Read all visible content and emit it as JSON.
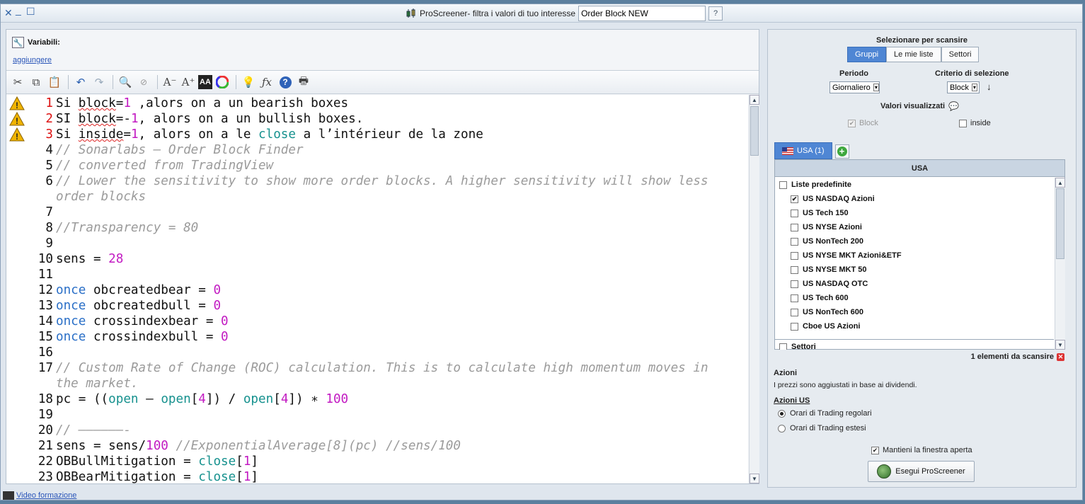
{
  "window": {
    "title": "ProScreener- filtra i valori di tuo interesse",
    "screener_name": "Order Block NEW"
  },
  "variables": {
    "title": "Variabili:",
    "add_link": "aggiungere"
  },
  "toolbar": {
    "icons": [
      "cut-icon",
      "copy-icon",
      "paste-icon",
      "undo-icon",
      "redo-icon",
      "search-icon",
      "comment-icon",
      "font-decrease-icon",
      "font-increase-icon",
      "font-style-icon",
      "color-wheel-icon",
      "lightbulb-icon",
      "function-icon",
      "help-icon",
      "print-icon"
    ]
  },
  "editor": {
    "lines": [
      {
        "n": "1",
        "err": true,
        "segs": [
          [
            "t",
            "Si "
          ],
          [
            "sq",
            "block"
          ],
          [
            "t",
            "="
          ],
          [
            "num",
            "1"
          ],
          [
            "t",
            " ,alors on a un bearish boxes"
          ]
        ]
      },
      {
        "n": "2",
        "err": true,
        "segs": [
          [
            "t",
            "SI "
          ],
          [
            "sq",
            "block"
          ],
          [
            "t",
            "=-"
          ],
          [
            "num",
            "1"
          ],
          [
            "t",
            ", alors on a un bullish boxes."
          ]
        ]
      },
      {
        "n": "3",
        "err": true,
        "segs": [
          [
            "t",
            "Si "
          ],
          [
            "sq",
            "inside"
          ],
          [
            "t",
            "="
          ],
          [
            "num",
            "1"
          ],
          [
            "t",
            ", alors on a le "
          ],
          [
            "fn",
            "close"
          ],
          [
            "t",
            " a l’intérieur de la zone"
          ]
        ]
      },
      {
        "n": "4",
        "segs": [
          [
            "cm",
            "// Sonarlabs – Order Block Finder"
          ]
        ]
      },
      {
        "n": "5",
        "segs": [
          [
            "cm",
            "// converted from TradingView"
          ]
        ]
      },
      {
        "n": "6",
        "segs": [
          [
            "cm",
            "// Lower the sensitivity to show more order blocks. A higher sensitivity will show less"
          ]
        ]
      },
      {
        "n": "",
        "segs": [
          [
            "cm",
            "order blocks"
          ]
        ]
      },
      {
        "n": "7",
        "segs": []
      },
      {
        "n": "8",
        "segs": [
          [
            "cm",
            "//Transparency = 80"
          ]
        ]
      },
      {
        "n": "9",
        "segs": []
      },
      {
        "n": "10",
        "segs": [
          [
            "t",
            "sens = "
          ],
          [
            "num",
            "28"
          ]
        ]
      },
      {
        "n": "11",
        "segs": []
      },
      {
        "n": "12",
        "segs": [
          [
            "kw",
            "once"
          ],
          [
            "t",
            " obcreatedbear = "
          ],
          [
            "num",
            "0"
          ]
        ]
      },
      {
        "n": "13",
        "segs": [
          [
            "kw",
            "once"
          ],
          [
            "t",
            " obcreatedbull = "
          ],
          [
            "num",
            "0"
          ]
        ]
      },
      {
        "n": "14",
        "segs": [
          [
            "kw",
            "once"
          ],
          [
            "t",
            " crossindexbear = "
          ],
          [
            "num",
            "0"
          ]
        ]
      },
      {
        "n": "15",
        "segs": [
          [
            "kw",
            "once"
          ],
          [
            "t",
            " crossindexbull = "
          ],
          [
            "num",
            "0"
          ]
        ]
      },
      {
        "n": "16",
        "segs": []
      },
      {
        "n": "17",
        "segs": [
          [
            "cm",
            "// Custom Rate of Change (ROC) calculation. This is to calculate high momentum moves in"
          ]
        ]
      },
      {
        "n": "",
        "segs": [
          [
            "cm",
            "the market."
          ]
        ]
      },
      {
        "n": "18",
        "segs": [
          [
            "t",
            "pc = (("
          ],
          [
            "fn",
            "open"
          ],
          [
            "t",
            " – "
          ],
          [
            "fn",
            "open"
          ],
          [
            "t",
            "["
          ],
          [
            "num",
            "4"
          ],
          [
            "t",
            "]) / "
          ],
          [
            "fn",
            "open"
          ],
          [
            "t",
            "["
          ],
          [
            "num",
            "4"
          ],
          [
            "t",
            "]) ∗ "
          ],
          [
            "num",
            "100"
          ]
        ]
      },
      {
        "n": "19",
        "segs": []
      },
      {
        "n": "20",
        "segs": [
          [
            "cm",
            "// ––––––-"
          ]
        ]
      },
      {
        "n": "21",
        "segs": [
          [
            "t",
            "sens = sens/"
          ],
          [
            "num",
            "100"
          ],
          [
            "t",
            " "
          ],
          [
            "cm",
            "//ExponentialAverage[8](pc) //sens/100"
          ]
        ]
      },
      {
        "n": "22",
        "segs": [
          [
            "t",
            "OBBullMitigation = "
          ],
          [
            "fn",
            "close"
          ],
          [
            "t",
            "["
          ],
          [
            "num",
            "1"
          ],
          [
            "t",
            "]"
          ]
        ]
      },
      {
        "n": "23",
        "segs": [
          [
            "t",
            "OBBearMitigation = "
          ],
          [
            "fn",
            "close"
          ],
          [
            "t",
            "["
          ],
          [
            "num",
            "1"
          ],
          [
            "t",
            "]"
          ]
        ]
      }
    ]
  },
  "footer": {
    "video_link": "Video formazione"
  },
  "scan": {
    "title": "Selezionare per scansire",
    "tabs": [
      {
        "label": "Gruppi",
        "active": true
      },
      {
        "label": "Le mie liste",
        "active": false
      },
      {
        "label": "Settori",
        "active": false
      }
    ],
    "period_label": "Periodo",
    "period_value": "Giornaliero",
    "criteria_label": "Criterio di selezione",
    "criteria_value": "Block",
    "sort_arrow": "↓",
    "displayed_label": "Valori visualizzati",
    "displayed": [
      {
        "label": "Block",
        "checked": true,
        "disabled": true
      },
      {
        "label": "inside",
        "checked": false,
        "disabled": false
      }
    ],
    "group_tab": "USA (1)",
    "list_header": "USA",
    "list": [
      {
        "label": "Liste predefinite",
        "checked": false,
        "indent": false
      },
      {
        "label": "US NASDAQ Azioni",
        "checked": true,
        "indent": true
      },
      {
        "label": "US Tech 150",
        "checked": false,
        "indent": true
      },
      {
        "label": "US NYSE Azioni",
        "checked": false,
        "indent": true
      },
      {
        "label": "US NonTech 200",
        "checked": false,
        "indent": true
      },
      {
        "label": "US NYSE MKT Azioni&ETF",
        "checked": false,
        "indent": true
      },
      {
        "label": "US NYSE MKT 50",
        "checked": false,
        "indent": true
      },
      {
        "label": "US NASDAQ OTC",
        "checked": false,
        "indent": true
      },
      {
        "label": "US Tech 600",
        "checked": false,
        "indent": true
      },
      {
        "label": "US NonTech 600",
        "checked": false,
        "indent": true
      },
      {
        "label": "Cboe US Azioni",
        "checked": false,
        "indent": true
      },
      {
        "label": "Settori",
        "checked": false,
        "indent": false
      }
    ],
    "count_text": "1 elementi da scansire",
    "stocks_title": "Azioni",
    "stocks_note": "I prezzi sono aggiustati in base ai dividendi.",
    "us_title": "Azioni US",
    "hours": [
      {
        "label": "Orari di Trading regolari",
        "selected": true
      },
      {
        "label": "Orari di Trading estesi",
        "selected": false
      }
    ],
    "keep_open_label": "Mantieni la finestra aperta",
    "keep_open_checked": true,
    "run_button": "Esegui ProScreener"
  },
  "colors": {
    "accent": "#4f86d4",
    "keyword": "#2a6fc7",
    "function": "#16918e",
    "number": "#c21ac2",
    "comment": "#9b9b9b",
    "error_line": "#d11111"
  }
}
